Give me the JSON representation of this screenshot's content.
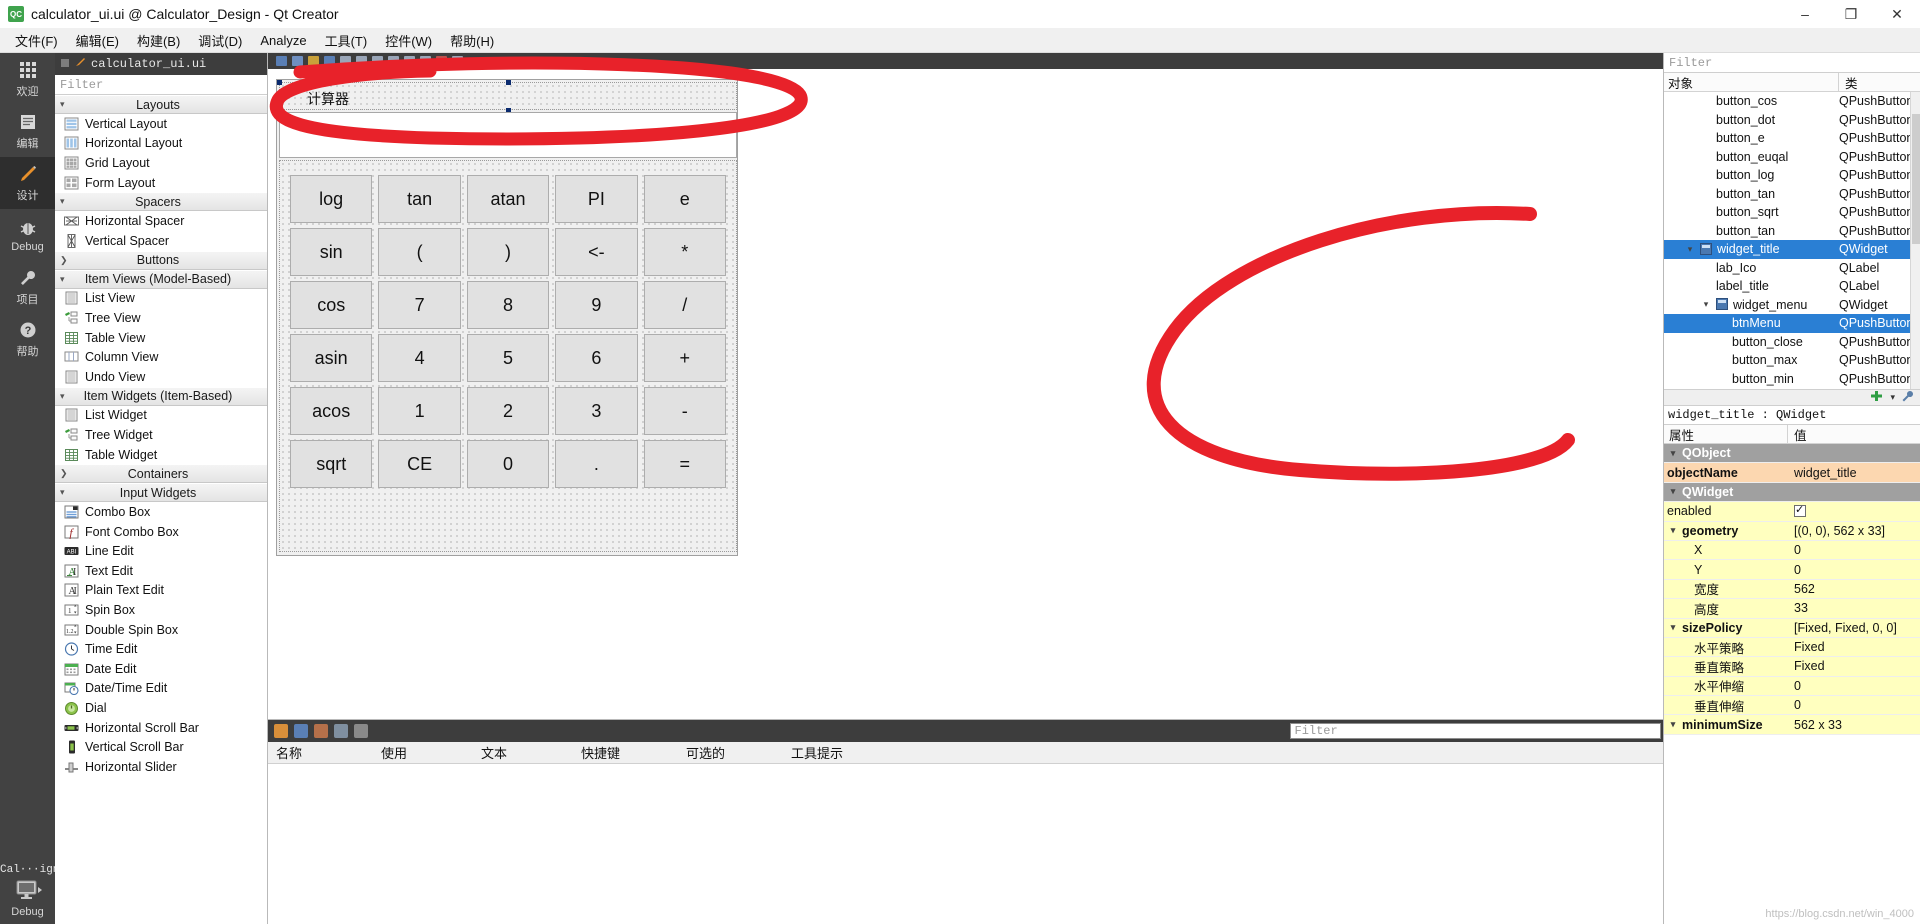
{
  "window": {
    "title": "calculator_ui.ui @ Calculator_Design - Qt Creator",
    "app_icon": "qt-creator-icon",
    "minimize": "–",
    "maximize": "❐",
    "close": "✕"
  },
  "menubar": {
    "items": [
      {
        "label": "文件(F)",
        "name": "menu-file"
      },
      {
        "label": "编辑(E)",
        "name": "menu-edit"
      },
      {
        "label": "构建(B)",
        "name": "menu-build"
      },
      {
        "label": "调试(D)",
        "name": "menu-debug"
      },
      {
        "label": "Analyze",
        "name": "menu-analyze"
      },
      {
        "label": "工具(T)",
        "name": "menu-tools"
      },
      {
        "label": "控件(W)",
        "name": "menu-window"
      },
      {
        "label": "帮助(H)",
        "name": "menu-help"
      }
    ]
  },
  "modebar": {
    "modes": [
      {
        "label": "欢迎",
        "icon": "grid-icon",
        "active": false
      },
      {
        "label": "编辑",
        "icon": "document-icon",
        "active": false
      },
      {
        "label": "设计",
        "icon": "pencil-icon",
        "active": true
      },
      {
        "label": "Debug",
        "icon": "bug-icon",
        "active": false
      },
      {
        "label": "项目",
        "icon": "wrench-icon",
        "active": false
      },
      {
        "label": "帮助",
        "icon": "question-icon",
        "active": false
      }
    ],
    "kit_label": "Cal···ign",
    "run_config": "Debug",
    "run_icon": "monitor-icon"
  },
  "editor_tab": {
    "filename": "calculator_ui.ui",
    "icon": "ui-file-icon"
  },
  "widgetbox": {
    "filter_placeholder": "Filter",
    "groups": [
      {
        "name": "Layouts",
        "expanded": true,
        "items": [
          {
            "label": "Vertical Layout",
            "icon": "vertical-layout-icon"
          },
          {
            "label": "Horizontal Layout",
            "icon": "horizontal-layout-icon"
          },
          {
            "label": "Grid Layout",
            "icon": "grid-layout-icon"
          },
          {
            "label": "Form Layout",
            "icon": "form-layout-icon"
          }
        ]
      },
      {
        "name": "Spacers",
        "expanded": true,
        "items": [
          {
            "label": "Horizontal Spacer",
            "icon": "horizontal-spacer-icon"
          },
          {
            "label": "Vertical Spacer",
            "icon": "vertical-spacer-icon"
          }
        ]
      },
      {
        "name": "Buttons",
        "expanded": false,
        "items": []
      },
      {
        "name": "Item Views (Model-Based)",
        "expanded": true,
        "items": [
          {
            "label": "List View",
            "icon": "list-view-icon"
          },
          {
            "label": "Tree View",
            "icon": "tree-view-icon"
          },
          {
            "label": "Table View",
            "icon": "table-view-icon"
          },
          {
            "label": "Column View",
            "icon": "column-view-icon"
          },
          {
            "label": "Undo View",
            "icon": "undo-view-icon"
          }
        ]
      },
      {
        "name": "Item Widgets (Item-Based)",
        "expanded": true,
        "items": [
          {
            "label": "List Widget",
            "icon": "list-widget-icon"
          },
          {
            "label": "Tree Widget",
            "icon": "tree-widget-icon"
          },
          {
            "label": "Table Widget",
            "icon": "table-widget-icon"
          }
        ]
      },
      {
        "name": "Containers",
        "expanded": false,
        "items": []
      },
      {
        "name": "Input Widgets",
        "expanded": true,
        "items": [
          {
            "label": "Combo Box",
            "icon": "combo-box-icon"
          },
          {
            "label": "Font Combo Box",
            "icon": "font-combo-box-icon"
          },
          {
            "label": "Line Edit",
            "icon": "line-edit-icon"
          },
          {
            "label": "Text Edit",
            "icon": "text-edit-icon"
          },
          {
            "label": "Plain Text Edit",
            "icon": "plain-text-edit-icon"
          },
          {
            "label": "Spin Box",
            "icon": "spin-box-icon"
          },
          {
            "label": "Double Spin Box",
            "icon": "double-spin-box-icon"
          },
          {
            "label": "Time Edit",
            "icon": "time-edit-icon"
          },
          {
            "label": "Date Edit",
            "icon": "date-edit-icon"
          },
          {
            "label": "Date/Time Edit",
            "icon": "date-time-edit-icon"
          },
          {
            "label": "Dial",
            "icon": "dial-icon"
          },
          {
            "label": "Horizontal Scroll Bar",
            "icon": "horizontal-scroll-bar-icon"
          },
          {
            "label": "Vertical Scroll Bar",
            "icon": "vertical-scroll-bar-icon"
          },
          {
            "label": "Horizontal Slider",
            "icon": "horizontal-slider-icon"
          }
        ]
      }
    ]
  },
  "canvas": {
    "form_title": "计算器",
    "buttons": [
      [
        "log",
        "tan",
        "atan",
        "PI",
        "e"
      ],
      [
        "sin",
        "(",
        ")",
        "<-",
        "*"
      ],
      [
        "cos",
        "7",
        "8",
        "9",
        "/"
      ],
      [
        "asin",
        "4",
        "5",
        "6",
        "+"
      ],
      [
        "acos",
        "1",
        "2",
        "3",
        "-"
      ],
      [
        "sqrt",
        "CE",
        "0",
        ".",
        "="
      ]
    ]
  },
  "bottom_dock": {
    "filter_placeholder": "Filter",
    "columns": [
      "名称",
      "使用",
      "文本",
      "快捷键",
      "可选的",
      "工具提示"
    ],
    "toolbar_icons": [
      "action-editor-icon",
      "copy-icon",
      "new-action-icon",
      "delete-icon",
      "configure-icon"
    ]
  },
  "object_inspector": {
    "filter_placeholder": "Filter",
    "columns": [
      "对象",
      "类"
    ],
    "rows": [
      {
        "name": "button_cos",
        "class": "QPushButton",
        "indent": 3,
        "twisty": "",
        "selected": false
      },
      {
        "name": "button_dot",
        "class": "QPushButton",
        "indent": 3,
        "twisty": "",
        "selected": false
      },
      {
        "name": "button_e",
        "class": "QPushButton",
        "indent": 3,
        "twisty": "",
        "selected": false
      },
      {
        "name": "button_euqal",
        "class": "QPushButton",
        "indent": 3,
        "twisty": "",
        "selected": false
      },
      {
        "name": "button_log",
        "class": "QPushButton",
        "indent": 3,
        "twisty": "",
        "selected": false
      },
      {
        "name": "button_tan",
        "class": "QPushButton",
        "indent": 3,
        "twisty": "",
        "selected": false
      },
      {
        "name": "button_sqrt",
        "class": "QPushButton",
        "indent": 3,
        "twisty": "",
        "selected": false
      },
      {
        "name": "button_tan",
        "class": "QPushButton",
        "indent": 3,
        "twisty": "",
        "selected": false
      },
      {
        "name": "widget_title",
        "class": "QWidget",
        "indent": 2,
        "twisty": "v",
        "selected": true
      },
      {
        "name": "lab_Ico",
        "class": "QLabel",
        "indent": 3,
        "twisty": "",
        "selected": false
      },
      {
        "name": "label_title",
        "class": "QLabel",
        "indent": 3,
        "twisty": "",
        "selected": false
      },
      {
        "name": "widget_menu",
        "class": "QWidget",
        "indent": 3,
        "twisty": "v",
        "selected": false
      },
      {
        "name": "btnMenu",
        "class": "QPushButton",
        "indent": 4,
        "twisty": "",
        "selected": true
      },
      {
        "name": "button_close",
        "class": "QPushButton",
        "indent": 4,
        "twisty": "",
        "selected": false
      },
      {
        "name": "button_max",
        "class": "QPushButton",
        "indent": 4,
        "twisty": "",
        "selected": false
      },
      {
        "name": "button_min",
        "class": "QPushButton",
        "indent": 4,
        "twisty": "",
        "selected": false
      }
    ]
  },
  "property_editor": {
    "object_name_field": "widget_title : QWidget",
    "columns": [
      "属性",
      "值"
    ],
    "rows": [
      {
        "kind": "group",
        "key": "QObject",
        "value": "",
        "twisty": "v"
      },
      {
        "kind": "orange",
        "key": "objectName",
        "value": "widget_title"
      },
      {
        "kind": "group",
        "key": "QWidget",
        "value": "",
        "twisty": "v"
      },
      {
        "kind": "yellow-check",
        "key": "enabled",
        "value": ""
      },
      {
        "kind": "yellow-bold",
        "key": "geometry",
        "value": "[(0, 0), 562 x 33]",
        "twisty": "v"
      },
      {
        "kind": "yellow",
        "key": "X",
        "value": "0",
        "indent": true
      },
      {
        "kind": "yellow",
        "key": "Y",
        "value": "0",
        "indent": true
      },
      {
        "kind": "yellow",
        "key": "宽度",
        "value": "562",
        "indent": true
      },
      {
        "kind": "yellow",
        "key": "高度",
        "value": "33",
        "indent": true
      },
      {
        "kind": "yellow-bold",
        "key": "sizePolicy",
        "value": "[Fixed, Fixed, 0, 0]",
        "twisty": "v"
      },
      {
        "kind": "yellow",
        "key": "水平策略",
        "value": "Fixed",
        "indent": true
      },
      {
        "kind": "yellow",
        "key": "垂直策略",
        "value": "Fixed",
        "indent": true
      },
      {
        "kind": "yellow",
        "key": "水平伸缩",
        "value": "0",
        "indent": true
      },
      {
        "kind": "yellow",
        "key": "垂直伸缩",
        "value": "0",
        "indent": true
      },
      {
        "kind": "yellow-bold",
        "key": "minimumSize",
        "value": "562 x 33",
        "twisty": "v"
      }
    ]
  },
  "annotations": {
    "color": "#e8222a",
    "shapes": [
      "ellipse-around-form-title",
      "ellipse-around-object-tree"
    ]
  },
  "watermark": "https://blog.csdn.net/win_4000"
}
